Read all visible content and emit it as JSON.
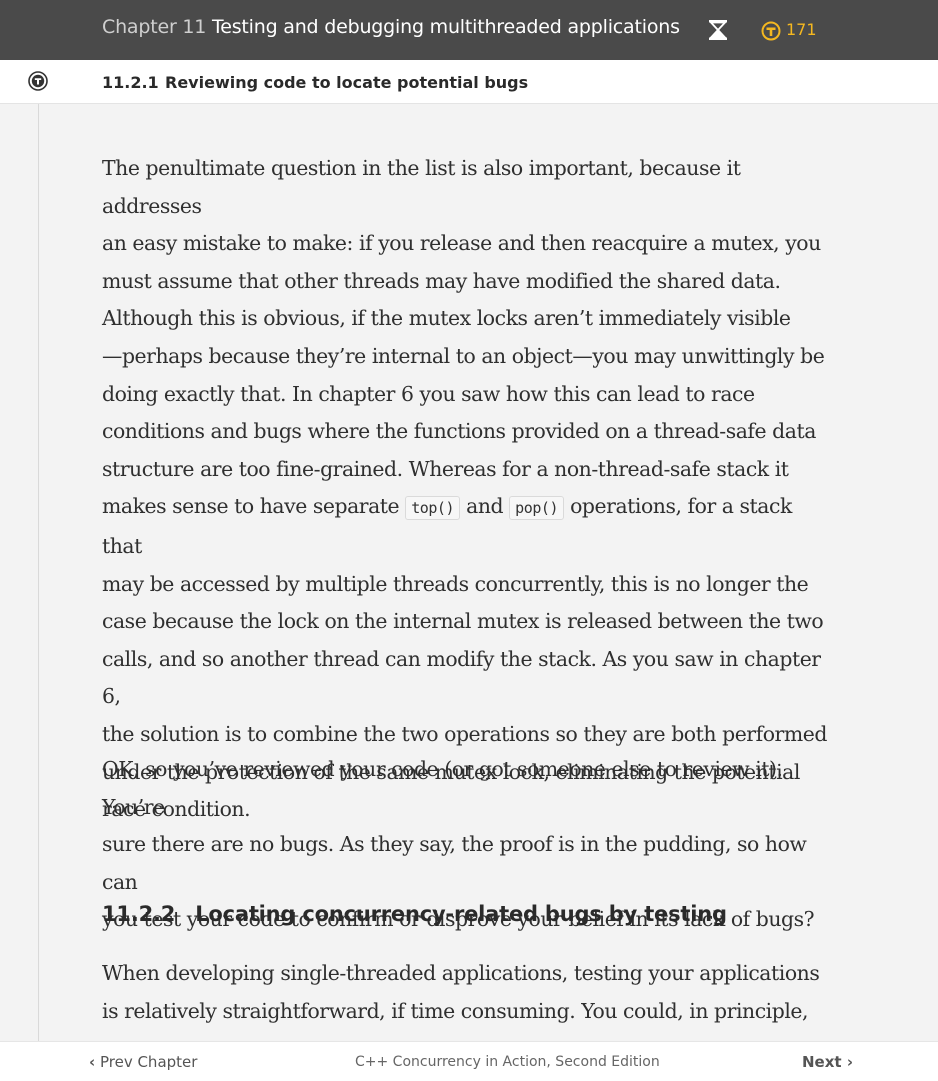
{
  "header": {
    "chapter_number": "Chapter 11",
    "chapter_title": "Testing and debugging multithreaded applications",
    "token_count": "171",
    "hourglass_icon": "hourglass-icon",
    "token_icon": "token-icon",
    "accent_color": "#f5b820"
  },
  "section_bar": {
    "logo_icon": "manning-logo-icon",
    "number": "11.2.1",
    "title": "Reviewing code to locate potential bugs"
  },
  "content": {
    "p1": [
      "The penultimate question in the list is also important, because it addresses",
      "an easy mistake to make: if you release and then reacquire a mutex, you",
      "must assume that other threads may have modified the shared data.",
      "Although this is obvious, if the mutex locks aren’t immediately visible",
      "—perhaps because they’re internal to an object—you may unwittingly be",
      "doing exactly that. In chapter 6 you saw how this can lead to race",
      "conditions and bugs where the functions provided on a thread-safe data",
      "structure are too fine-grained. Whereas for a non-thread-safe stack it"
    ],
    "p1_line9_a": "makes sense to have separate ",
    "code_top": "top()",
    "p1_line9_b": " and ",
    "code_pop": "pop()",
    "p1_line9_c": " operations, for a stack that",
    "p1_rest": [
      "may be accessed by multiple threads concurrently, this is no longer the",
      "case because the lock on the internal mutex is released between the two",
      "calls, and so another thread can modify the stack. As you saw in chapter 6,",
      "the solution is to combine the two operations so they are both performed",
      "under the protection of the same mutex lock, eliminating the potential",
      "race condition."
    ],
    "p2": [
      "OK, so you’ve reviewed your code (or got someone else to review it). You’re",
      "sure there are no bugs. As they say, the proof is in the pudding, so how can",
      "you test your code to confirm or disprove your belief in its lack of bugs?"
    ],
    "h3_number": "11.2.2",
    "h3_title": "Locating concurrency-related bugs by testing",
    "p3": [
      "When developing single-threaded applications, testing your applications",
      "is relatively straightforward, if time consuming. You could, in principle,"
    ]
  },
  "footer": {
    "prev_label": "Prev Chapter",
    "book_title": "C++ Concurrency in Action, Second Edition",
    "next_label": "Next"
  }
}
